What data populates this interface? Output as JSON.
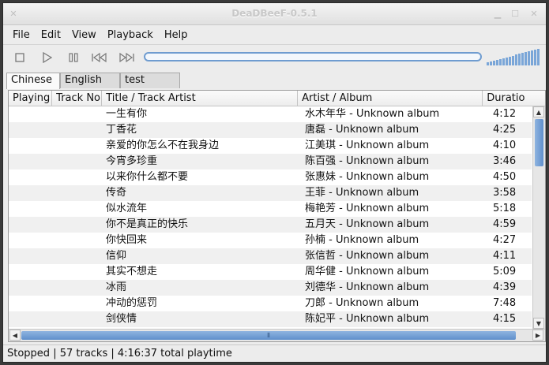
{
  "window": {
    "title": "DeaDBeeF-0.5.1"
  },
  "menu": [
    "File",
    "Edit",
    "View",
    "Playback",
    "Help"
  ],
  "toolbar": {
    "buttons": [
      "stop-icon",
      "play-icon",
      "pause-icon",
      "prev-icon",
      "next-icon"
    ],
    "seek_progress": 0,
    "volume_level": 1.0
  },
  "tabs": [
    "Chinese",
    "English",
    "test"
  ],
  "columns": [
    "Playing",
    "Track No",
    "Title / Track Artist",
    "Artist / Album",
    "Duratio"
  ],
  "tracks": [
    {
      "title": "一生有你",
      "artist_album": "水木年华 - Unknown album",
      "duration": "4:12"
    },
    {
      "title": "丁香花",
      "artist_album": "唐磊 - Unknown album",
      "duration": "4:25"
    },
    {
      "title": "亲爱的你怎么不在我身边",
      "artist_album": "江美琪 - Unknown album",
      "duration": "4:10"
    },
    {
      "title": "今宵多珍重",
      "artist_album": "陈百强 - Unknown album",
      "duration": "3:46"
    },
    {
      "title": "以来你什么都不要",
      "artist_album": "张惠妹 - Unknown album",
      "duration": "4:50"
    },
    {
      "title": "传奇",
      "artist_album": "王菲 - Unknown album",
      "duration": "3:58"
    },
    {
      "title": "似水流年",
      "artist_album": "梅艳芳 - Unknown album",
      "duration": "5:18"
    },
    {
      "title": "你不是真正的快乐",
      "artist_album": "五月天 - Unknown album",
      "duration": "4:59"
    },
    {
      "title": "你快回来",
      "artist_album": "孙楠 - Unknown album",
      "duration": "4:27"
    },
    {
      "title": "信仰",
      "artist_album": "张信哲 - Unknown album",
      "duration": "4:11"
    },
    {
      "title": "其实不想走",
      "artist_album": "周华健 - Unknown album",
      "duration": "5:09"
    },
    {
      "title": "冰雨",
      "artist_album": "刘德华 - Unknown album",
      "duration": "4:39"
    },
    {
      "title": "冲动的惩罚",
      "artist_album": "刀郎 - Unknown album",
      "duration": "7:48"
    },
    {
      "title": "剑侠情",
      "artist_album": "陈妃平 - Unknown album",
      "duration": "4:15"
    }
  ],
  "status": "Stopped | 57 tracks | 4:16:37 total playtime",
  "colors": {
    "accent": "#6f9cd0",
    "scroll_thumb": "#5f8fcb"
  }
}
